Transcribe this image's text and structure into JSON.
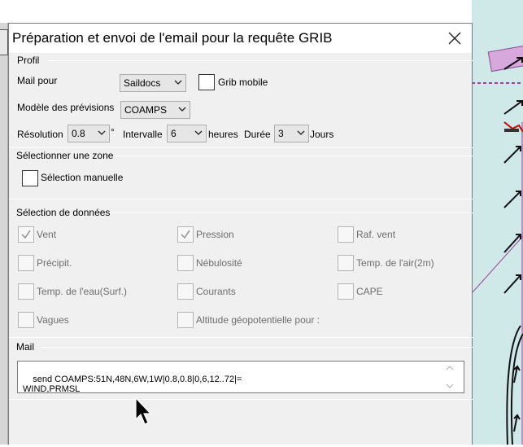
{
  "dialog": {
    "title": "Préparation et envoi de l'email pour la requête GRIB"
  },
  "profile": {
    "section": "Profil",
    "mail_for_label": "Mail pour",
    "mail_for_value": "Saildocs",
    "grib_mobile_label": "Grib mobile",
    "model_label": "Modèle des prévisions",
    "model_value": "COAMPS",
    "resolution_label": "Résolution",
    "resolution_value": "0.8",
    "resolution_unit": "°",
    "interval_label": "Intervalle",
    "interval_value": "6",
    "interval_unit": "heures",
    "duration_label": "Durée",
    "duration_value": "3",
    "duration_unit": "Jours"
  },
  "zone": {
    "section": "Sélectionner une zone",
    "manual_label": "Sélection manuelle"
  },
  "data": {
    "section": "Sélection de données",
    "items": [
      {
        "label": "Vent",
        "checked": true,
        "enabled": false
      },
      {
        "label": "Pression",
        "checked": true,
        "enabled": false
      },
      {
        "label": "Raf. vent",
        "checked": false,
        "enabled": false
      },
      {
        "label": "Précipit.",
        "checked": false,
        "enabled": false
      },
      {
        "label": "Nébulosité",
        "checked": false,
        "enabled": false
      },
      {
        "label": "Temp. de l'air(2m)",
        "checked": false,
        "enabled": false
      },
      {
        "label": "Temp. de l'eau(Surf.)",
        "checked": false,
        "enabled": false
      },
      {
        "label": "Courants",
        "checked": false,
        "enabled": false
      },
      {
        "label": "CAPE",
        "checked": false,
        "enabled": false
      },
      {
        "label": "Vagues",
        "checked": false,
        "enabled": false
      },
      {
        "label": "Altitude géopotentielle pour :",
        "checked": false,
        "enabled": false
      }
    ]
  },
  "mail": {
    "section": "Mail",
    "body": "send COAMPS:51N,48N,6W,1W|0.8,0.8|0,6,12..72|=\nWIND,PRMSL"
  },
  "icons": {
    "close": "close-icon",
    "chevron": "chevron-down-icon",
    "check": "check-icon",
    "cursor": "mouse-pointer-icon"
  },
  "colors": {
    "dialog_bg": "#f0f0f0",
    "chart_sea": "#cfe8e8",
    "route_line": "#a0409a",
    "disabled_text": "#6d6d6d"
  }
}
